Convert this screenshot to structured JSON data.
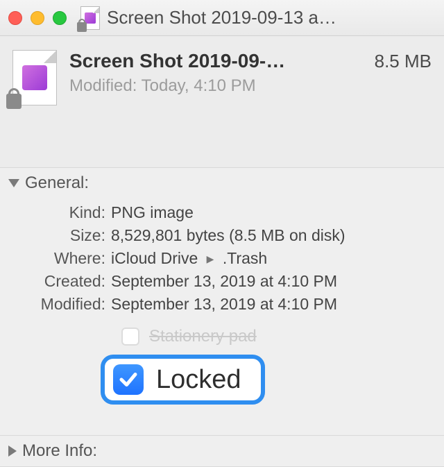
{
  "window": {
    "title": "Screen Shot 2019-09-13 a…"
  },
  "header": {
    "filename": "Screen Shot 2019-09-…",
    "size": "8.5 MB",
    "modified_label": "Modified:",
    "modified_value": "Today, 4:10 PM"
  },
  "sections": {
    "general": {
      "title": "General:",
      "kind_label": "Kind:",
      "kind_value": "PNG image",
      "size_label": "Size:",
      "size_value": "8,529,801 bytes (8.5 MB on disk)",
      "where_label": "Where:",
      "where_path": [
        "iCloud Drive",
        ".Trash"
      ],
      "created_label": "Created:",
      "created_value": "September 13, 2019 at 4:10 PM",
      "modified_label": "Modified:",
      "modified_value": "September 13, 2019 at 4:10 PM",
      "stationery_label": "Stationery pad",
      "stationery_checked": false,
      "stationery_enabled": false,
      "locked_label": "Locked",
      "locked_checked": true
    },
    "more_info": {
      "title": "More Info:"
    }
  }
}
